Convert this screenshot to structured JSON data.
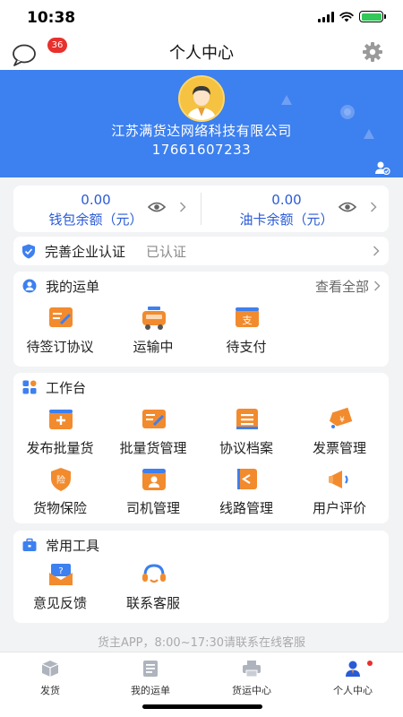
{
  "status_bar": {
    "time": "10:38"
  },
  "header": {
    "title": "个人中心",
    "message_badge": "36"
  },
  "profile": {
    "company": "江苏满货达网络科技有限公司",
    "phone": "17661607233"
  },
  "balances": [
    {
      "value": "0.00",
      "label": "钱包余额（元）"
    },
    {
      "value": "0.00",
      "label": "油卡余额（元）"
    }
  ],
  "certification": {
    "title": "完善企业认证",
    "status": "已认证"
  },
  "orders": {
    "title": "我的运单",
    "more": "查看全部",
    "items": [
      {
        "label": "待签订协议",
        "icon": "contract-sign-icon"
      },
      {
        "label": "运输中",
        "icon": "truck-icon"
      },
      {
        "label": "待支付",
        "icon": "payment-icon"
      }
    ]
  },
  "workbench": {
    "title": "工作台",
    "items": [
      {
        "label": "发布批量货",
        "icon": "publish-cargo-icon"
      },
      {
        "label": "批量货管理",
        "icon": "cargo-manage-icon"
      },
      {
        "label": "协议档案",
        "icon": "agreement-archive-icon"
      },
      {
        "label": "发票管理",
        "icon": "invoice-icon"
      },
      {
        "label": "货物保险",
        "icon": "insurance-icon"
      },
      {
        "label": "司机管理",
        "icon": "driver-icon"
      },
      {
        "label": "线路管理",
        "icon": "route-flag-icon"
      },
      {
        "label": "用户评价",
        "icon": "megaphone-icon"
      }
    ]
  },
  "common_tools": {
    "title": "常用工具",
    "items": [
      {
        "label": "意见反馈",
        "icon": "feedback-icon"
      },
      {
        "label": "联系客服",
        "icon": "headset-icon"
      }
    ]
  },
  "footer_note": "货主APP，8:00~17:30请联系在线客服",
  "tabbar": [
    {
      "label": "发货",
      "icon": "box-icon"
    },
    {
      "label": "我的运单",
      "icon": "waybill-icon"
    },
    {
      "label": "货运中心",
      "icon": "printer-icon"
    },
    {
      "label": "个人中心",
      "icon": "user-icon",
      "active": true
    }
  ],
  "colors": {
    "primary": "#3d80ef",
    "accent_orange": "#f28b2e",
    "link_blue": "#2a5bd7",
    "badge_red": "#e8302c"
  }
}
